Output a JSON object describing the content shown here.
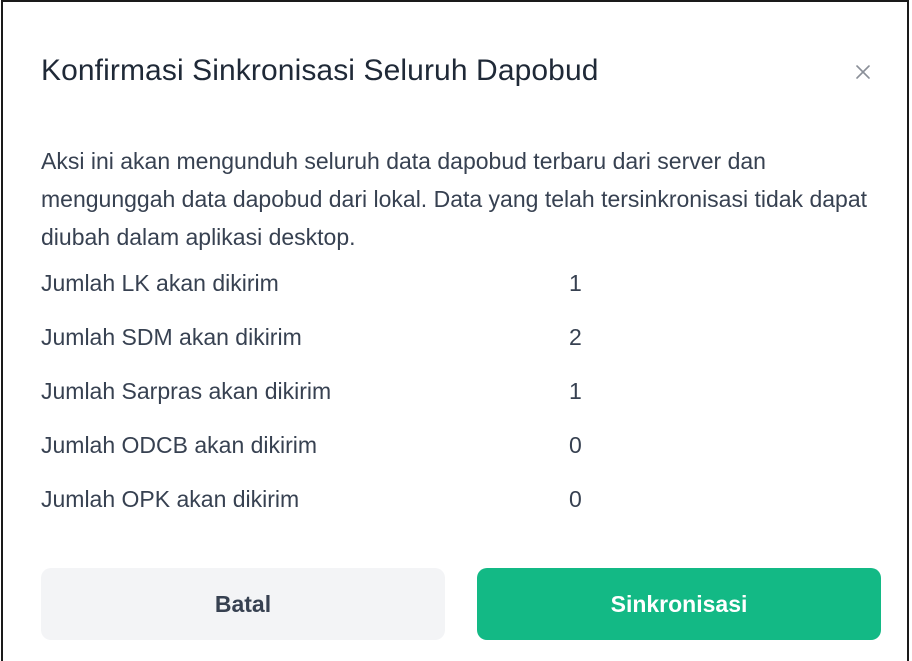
{
  "dialog": {
    "title": "Konfirmasi Sinkronisasi Seluruh Dapobud",
    "close_icon": "close-icon",
    "description": "Aksi ini akan mengunduh seluruh data dapobud terbaru dari server dan mengunggah data dapobud dari lokal. Data yang telah tersinkronisasi tidak dapat diubah dalam aplikasi desktop.",
    "stats": [
      {
        "label": "Jumlah LK akan dikirim",
        "value": "1"
      },
      {
        "label": "Jumlah SDM akan dikirim",
        "value": "2"
      },
      {
        "label": "Jumlah Sarpras akan dikirim",
        "value": "1"
      },
      {
        "label": "Jumlah ODCB akan dikirim",
        "value": "0"
      },
      {
        "label": "Jumlah OPK akan dikirim",
        "value": "0"
      }
    ],
    "cancel_label": "Batal",
    "sync_label": "Sinkronisasi"
  },
  "colors": {
    "primary": "#13b985",
    "secondary_bg": "#f3f4f6",
    "text": "#374151"
  }
}
